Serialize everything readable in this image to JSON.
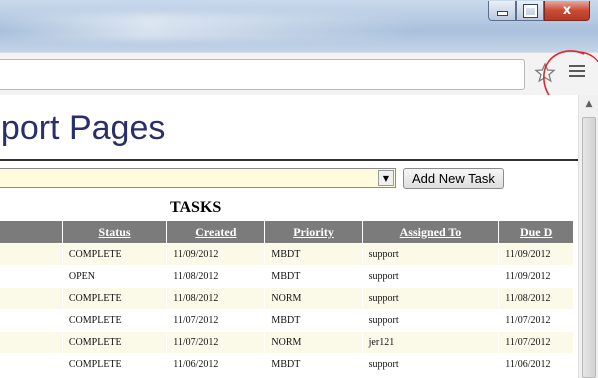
{
  "window": {
    "controls": [
      "minimize",
      "maximize",
      "close"
    ]
  },
  "toolbar": {
    "star_icon": "star-outline-icon",
    "menu_icon": "hamburger-menu-icon",
    "annotation_color": "#e0242b"
  },
  "page": {
    "title": "pport Pages",
    "select_value": "",
    "add_task_label": "Add New Task",
    "tasks_heading": "TASKS"
  },
  "table": {
    "headers": [
      "",
      "Status",
      "Created",
      "Priority",
      "Assigned To",
      "Due D"
    ],
    "rows": [
      {
        "status": "COMPLETE",
        "created": "11/09/2012",
        "priority": "MBDT",
        "assigned": "support",
        "due": "11/09/2012"
      },
      {
        "status": "OPEN",
        "created": "11/08/2012",
        "priority": "MBDT",
        "assigned": "support",
        "due": "11/09/2012"
      },
      {
        "status": "COMPLETE",
        "created": "11/08/2012",
        "priority": "NORM",
        "assigned": "support",
        "due": "11/08/2012"
      },
      {
        "status": "COMPLETE",
        "created": "11/07/2012",
        "priority": "MBDT",
        "assigned": "support",
        "due": "11/07/2012"
      },
      {
        "status": "COMPLETE",
        "created": "11/07/2012",
        "priority": "NORM",
        "assigned": "jer121",
        "due": "11/07/2012"
      },
      {
        "status": "COMPLETE",
        "created": "11/06/2012",
        "priority": "MBDT",
        "assigned": "support",
        "due": "11/06/2012"
      }
    ]
  },
  "colors": {
    "header_bg": "#7b7b7b",
    "row_alt_bg": "#fbf9e7",
    "title_color": "#2a2f6a"
  }
}
